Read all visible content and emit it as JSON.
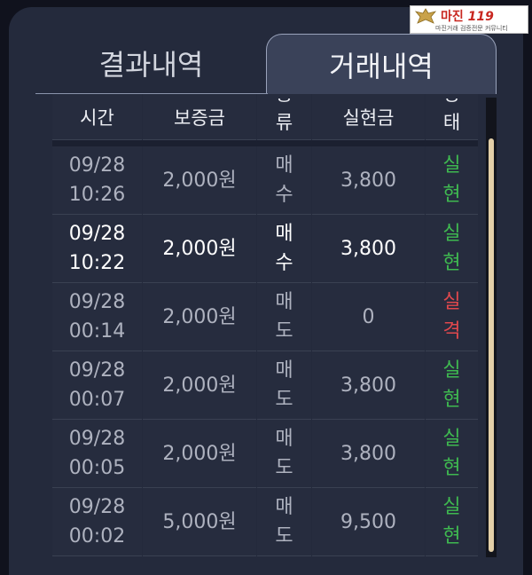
{
  "tabs": {
    "result": "결과내역",
    "trade": "거래내역"
  },
  "table": {
    "headers": {
      "time": "시간",
      "deposit": "보증금",
      "type_top": "종",
      "type": "류",
      "price": "실현금",
      "status_top": "상",
      "status": "태"
    },
    "rows": [
      {
        "date": "09/28",
        "time": "10:26",
        "deposit": "2,000원",
        "type1": "매",
        "type2": "수",
        "price": "3,800",
        "st1": "실",
        "st2": "현"
      },
      {
        "date": "09/28",
        "time": "10:22",
        "deposit": "2,000원",
        "type1": "매",
        "type2": "수",
        "price": "3,800",
        "st1": "실",
        "st2": "현"
      },
      {
        "date": "09/28",
        "time": "00:14",
        "deposit": "2,000원",
        "type1": "매",
        "type2": "도",
        "price": "0",
        "st1": "실",
        "st2": "격"
      },
      {
        "date": "09/28",
        "time": "00:07",
        "deposit": "2,000원",
        "type1": "매",
        "type2": "도",
        "price": "3,800",
        "st1": "실",
        "st2": "현"
      },
      {
        "date": "09/28",
        "time": "00:05",
        "deposit": "2,000원",
        "type1": "매",
        "type2": "도",
        "price": "3,800",
        "st1": "실",
        "st2": "현"
      },
      {
        "date": "09/28",
        "time": "00:02",
        "deposit": "5,000원",
        "type1": "매",
        "type2": "도",
        "price": "9,500",
        "st1": "실",
        "st2": "현"
      }
    ]
  },
  "logo": {
    "title": "마진",
    "number": "119",
    "subtitle": "마진거래 검증전문 커뮤니티"
  },
  "colors": {
    "status_success": "#3fb950",
    "status_fail": "#e0484d"
  }
}
